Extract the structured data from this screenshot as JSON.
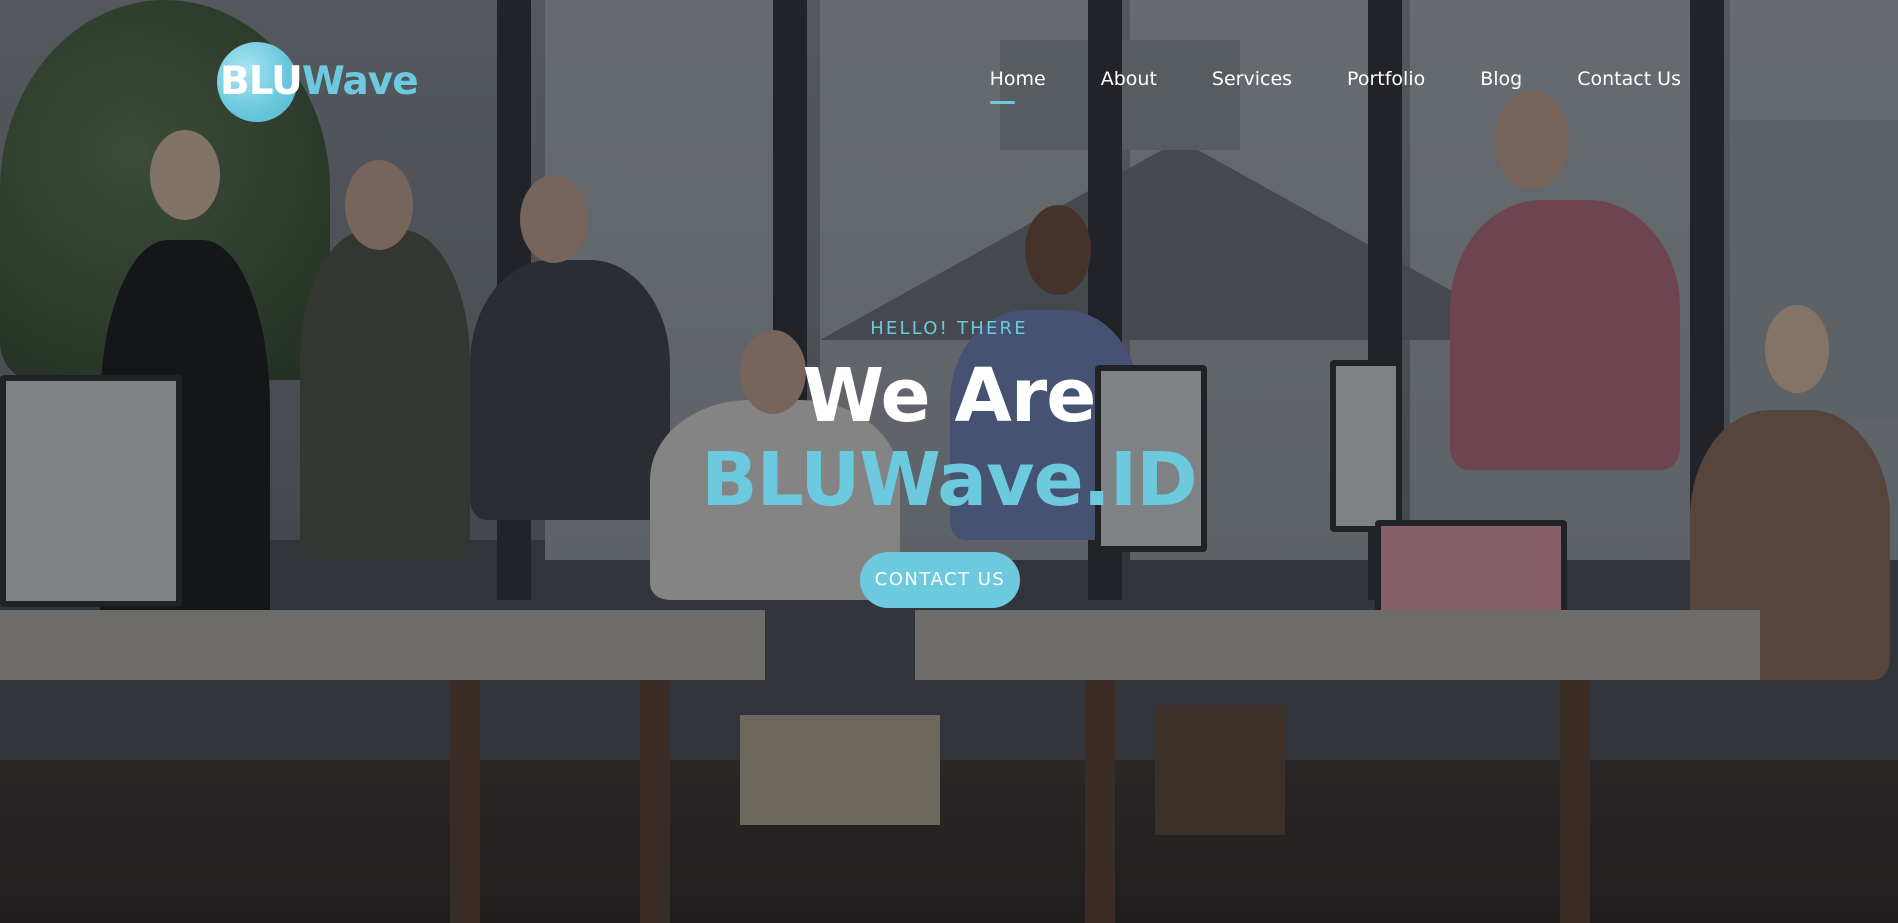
{
  "brand": {
    "logo_part1": "BLU",
    "logo_part2": "Wave",
    "accent_color": "#6cc9de",
    "text_color": "#ffffff"
  },
  "nav": {
    "items": [
      {
        "label": "Home",
        "active": true
      },
      {
        "label": "About",
        "active": false
      },
      {
        "label": "Services",
        "active": false
      },
      {
        "label": "Portfolio",
        "active": false
      },
      {
        "label": "Blog",
        "active": false
      },
      {
        "label": "Contact Us",
        "active": false
      }
    ]
  },
  "hero": {
    "eyebrow": "HELLO! THERE",
    "headline_line1": "We Are",
    "headline_line2": "BLUWave.ID",
    "cta_label": "CONTACT US"
  }
}
